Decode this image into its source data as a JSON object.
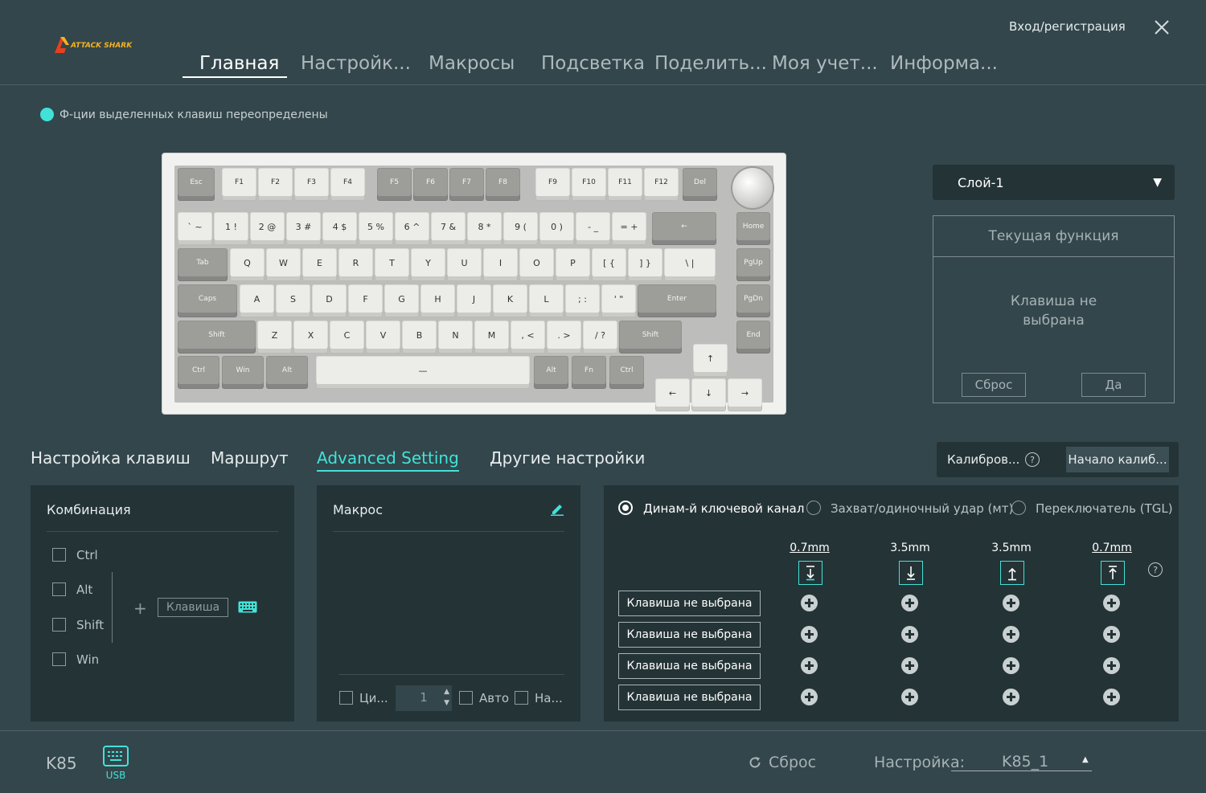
{
  "header": {
    "login": "Вход/регистрация",
    "logo_text": "ATTACK SHARK",
    "nav": [
      "Главная",
      "Настройк...",
      "Макросы",
      "Подсветка",
      "Поделить...",
      "Моя учет...",
      "Информа..."
    ]
  },
  "notice": "Ф-ции выделенных клавиш переопределены",
  "keyboard": {
    "rows": [
      [
        "Esc",
        "F1",
        "F2",
        "F3",
        "F4",
        "F5",
        "F6",
        "F7",
        "F8",
        "F9",
        "F10",
        "F11",
        "F12",
        "Del"
      ],
      [
        "` ~",
        "1 !",
        "2 @",
        "3 #",
        "4 $",
        "5 %",
        "6 ^",
        "7 &",
        "8 *",
        "9 (",
        "0 )",
        "- _",
        "= +",
        "←",
        "Home"
      ],
      [
        "Tab",
        "Q",
        "W",
        "E",
        "R",
        "T",
        "Y",
        "U",
        "I",
        "O",
        "P",
        "[ {",
        "] }",
        "\\ |",
        "PgUp"
      ],
      [
        "Caps",
        "A",
        "S",
        "D",
        "F",
        "G",
        "H",
        "J",
        "K",
        "L",
        "; :",
        "' \"",
        "Enter",
        "PgDn"
      ],
      [
        "Shift",
        "Z",
        "X",
        "C",
        "V",
        "B",
        "N",
        "M",
        ", <",
        ". >",
        "/ ?",
        "Shift",
        "↑",
        "End"
      ],
      [
        "Ctrl",
        "Win",
        "Alt",
        "—",
        "Alt",
        "Fn",
        "Ctrl",
        "←",
        "↓",
        "→"
      ]
    ]
  },
  "layer": {
    "value": "Слой-1"
  },
  "current_function": {
    "title": "Текущая функция",
    "text_line1": "Клавиша не",
    "text_line2": "выбрана",
    "reset": "Сброс",
    "ok": "Да"
  },
  "section_tabs": [
    "Настройка клавиш",
    "Маршрут",
    "Advanced Setting",
    "Другие настройки"
  ],
  "calibration": {
    "label": "Калибров...",
    "help": "?",
    "button": "Начало калиб..."
  },
  "combo": {
    "title": "Комбинация",
    "modifiers": [
      "Ctrl",
      "Alt",
      "Shift",
      "Win"
    ],
    "plus": "+",
    "key_placeholder": "Клавиша"
  },
  "macro": {
    "title": "Макрос",
    "cycle": "Ци...",
    "count": "1",
    "auto": "Авто",
    "other": "На..."
  },
  "advanced": {
    "modes": [
      "Динам-й ключевой канал",
      "Захват/одиночный удар (мт)",
      "Переключатель (TGL)"
    ],
    "selected_mode": 0,
    "depths": [
      "0.7mm",
      "3.5mm",
      "3.5mm",
      "0.7mm"
    ],
    "help": "?",
    "slots": [
      "Клавиша не выбрана",
      "Клавиша не выбрана",
      "Клавиша не выбрана",
      "Клавиша не выбрана"
    ]
  },
  "footer": {
    "model": "K85",
    "connection": "USB",
    "reset": "Сброс",
    "profile_label": "Настройка:",
    "profile_value": "K85_1"
  },
  "colors": {
    "accent": "#42e2d9",
    "background": "#33464b",
    "panel": "#243336"
  }
}
